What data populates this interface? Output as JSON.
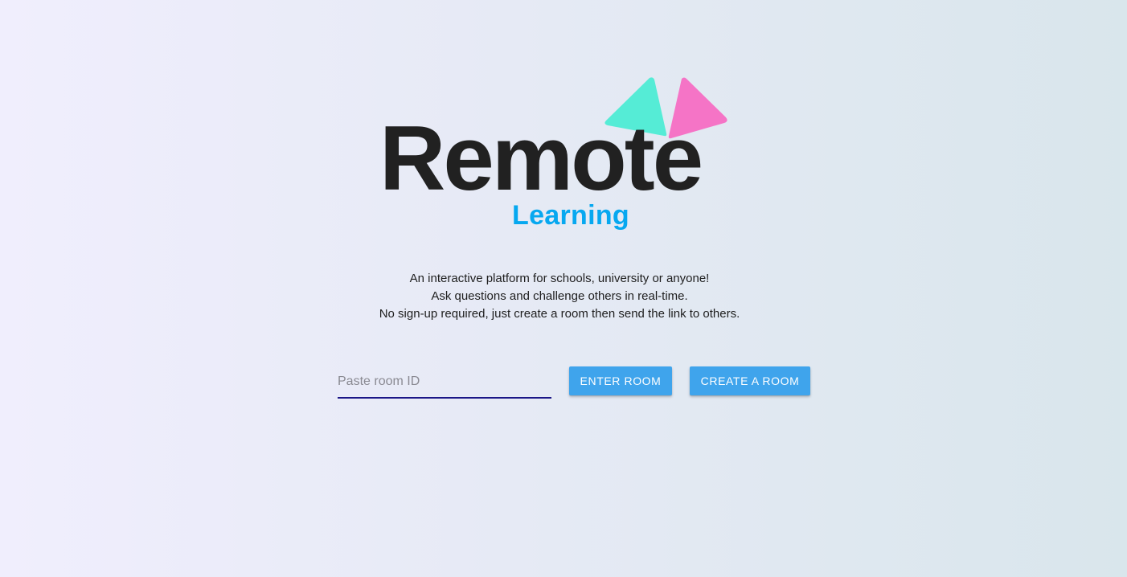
{
  "logo": {
    "word": "Remote",
    "subtitle": "Learning",
    "colors": {
      "word": "#212121",
      "subtitle": "#06a8f0",
      "triangle_left": "#55ecd6",
      "triangle_right": "#f574c6"
    }
  },
  "tagline": {
    "lines": [
      "An interactive platform for schools, university or anyone!",
      "Ask questions and challenge others in real-time.",
      "No sign-up required, just create a room then send the link to others."
    ]
  },
  "room_form": {
    "input_placeholder": "Paste room ID",
    "input_value": "",
    "enter_button": "Enter Room",
    "create_button": "Create a Room"
  },
  "colors": {
    "button_bg": "#3fa4ec",
    "input_underline": "#1b1687"
  }
}
